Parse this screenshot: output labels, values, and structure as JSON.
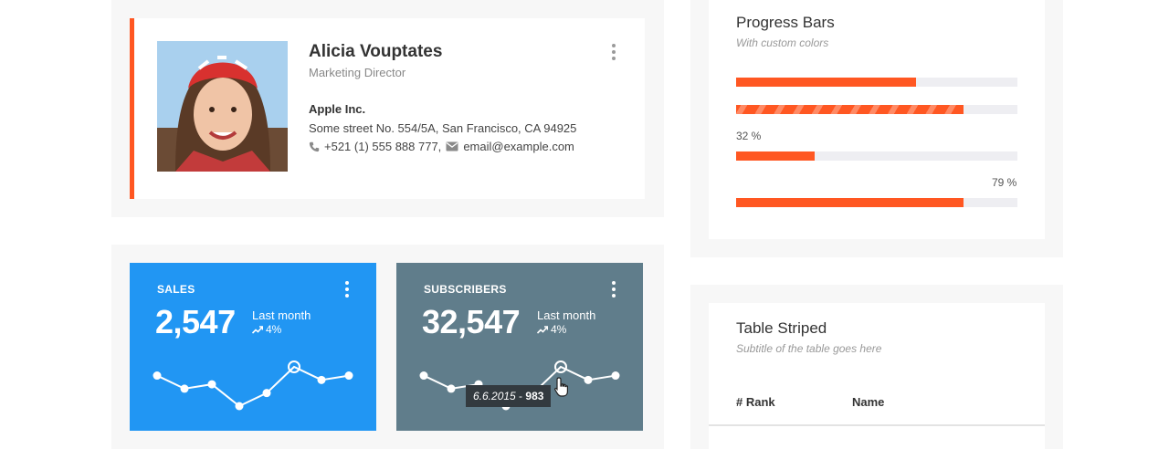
{
  "profile": {
    "name": "Alicia Vouptates",
    "job_title": "Marketing Director",
    "company": "Apple Inc.",
    "address": "Some street No. 554/5A, San Francisco, CA 94925",
    "phone": "+521 (1) 555 888 777,",
    "email": "email@example.com",
    "accent_color": "#ff5722"
  },
  "stats": {
    "sales": {
      "label": "SALES",
      "value": "2,547",
      "period": "Last month",
      "trend": "4%",
      "color": "#2196f3",
      "sparkline": [
        5,
        3.5,
        4,
        1.5,
        3,
        6,
        4.5,
        5
      ]
    },
    "subscribers": {
      "label": "SUBSCRIBERS",
      "value": "32,547",
      "period": "Last month",
      "trend": "4%",
      "color": "#607d8b",
      "sparkline": [
        5,
        3.5,
        4,
        1.5,
        3,
        6,
        4.5,
        5
      ],
      "tooltip": {
        "date": "6.6.2015",
        "separator": " - ",
        "value": "983"
      }
    }
  },
  "progress": {
    "title": "Progress Bars",
    "subtitle": "With custom colors",
    "bars": [
      {
        "value": 0.64,
        "striped": false,
        "label": ""
      },
      {
        "value": 0.81,
        "striped": true,
        "label": ""
      },
      {
        "value": 0.28,
        "striped": false,
        "label": "32 %"
      },
      {
        "value": 0.81,
        "striped": false,
        "label": "79 %"
      }
    ],
    "bar_color": "#ff5722"
  },
  "table": {
    "title": "Table Striped",
    "subtitle": "Subtitle of the table goes here",
    "columns": [
      "# Rank",
      "Name"
    ]
  }
}
